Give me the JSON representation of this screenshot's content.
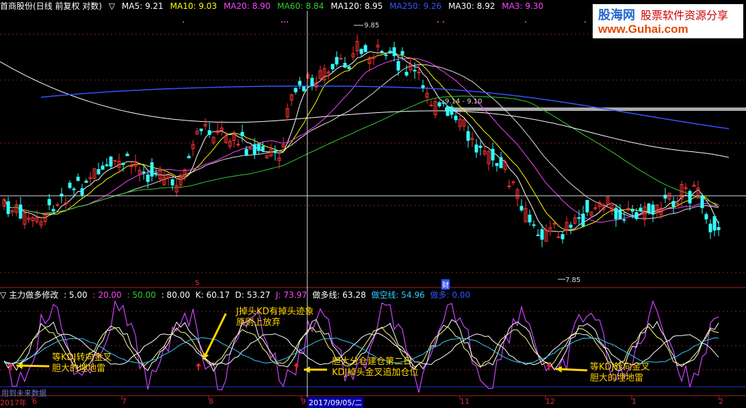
{
  "header": {
    "title": "首商股份(日线 前复权 对数)",
    "toggle": "▽",
    "ma": [
      {
        "label": "MA5: 9.21",
        "color": "#ffffff"
      },
      {
        "label": "MA10: 9.03",
        "color": "#ffff00"
      },
      {
        "label": "MA20: 8.90",
        "color": "#ff44ff"
      },
      {
        "label": "MA60: 8.84",
        "color": "#33cc33"
      },
      {
        "label": "MA120: 8.95",
        "color": "#ffffff"
      },
      {
        "label": "MA250: 9.26",
        "color": "#3355ff"
      },
      {
        "label": "MA30: 8.92",
        "color": "#ffffff"
      },
      {
        "label": "MA3: 9.30",
        "color": "#ff44ff"
      }
    ]
  },
  "logo": {
    "line1": "股海网",
    "line2": "股票软件资源分享",
    "url": "www.Guhai.com"
  },
  "price_labels": {
    "high": "9.85",
    "low": "7.85",
    "range": "9.14 - 9.10"
  },
  "event_markers": {
    "s": "S",
    "cai": "财"
  },
  "indicator": {
    "toggle": "▽",
    "name": "主力做多修改",
    "params": [
      {
        "label": ": 5.00",
        "color": "#ffffff"
      },
      {
        "label": ": 20.00",
        "color": "#ff44ff"
      },
      {
        "label": ": 50.00",
        "color": "#33cc33"
      },
      {
        "label": ": 80.00",
        "color": "#ffffff"
      },
      {
        "label": "K: 60.17",
        "color": "#ffffff"
      },
      {
        "label": "D: 53.27",
        "color": "#ffffff"
      },
      {
        "label": "J: 73.97",
        "color": "#ff44ff"
      },
      {
        "label": "做多线: 63.28",
        "color": "#ffffff"
      },
      {
        "label": "做空线: 54.96",
        "color": "#33ccff"
      },
      {
        "label": "做多: 0.00",
        "color": "#3355ff"
      }
    ]
  },
  "annotations": [
    {
      "lines": [
        "J掉头KD有掉头迹象",
        "原则上放弃"
      ]
    },
    {
      "lines": [
        "等KDJ转向金叉",
        "胆大的埋地雷"
      ]
    },
    {
      "lines": [
        "胆大分仓建仓第二日",
        "KDJ掉头金叉追加仓位"
      ]
    },
    {
      "lines": [
        "等KDJ转向金叉",
        "胆大的埋地雷"
      ]
    }
  ],
  "future_data": "用到未来数据",
  "date_axis": {
    "labels": [
      "2017年",
      "6",
      "7",
      "8",
      "9",
      "2017/09/05/二",
      "11",
      "12",
      "1",
      "2"
    ]
  },
  "colors": {
    "up": "#ff3333",
    "down": "#33ffff",
    "ma5": "#ffffff",
    "ma10": "#ffff00",
    "ma20": "#ff44ff",
    "ma60": "#33cc33",
    "ma250": "#3355ff",
    "j": "#cc44ff",
    "k": "#ffffff",
    "d": "#ffff88"
  }
}
